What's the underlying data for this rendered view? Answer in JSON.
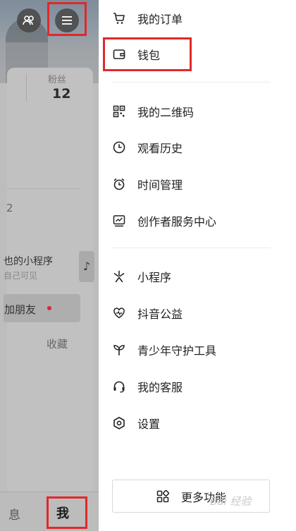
{
  "profile": {
    "fans_label": "粉丝",
    "fans_count": "12",
    "partial_char": "2",
    "mini_program_title": "也的小程序",
    "mini_program_sub": "自己可见",
    "add_friend_label": "加朋友",
    "favorites_tab": "收藏",
    "music_icon_glyph": "♪"
  },
  "bottom_tabs": {
    "messages": "息",
    "me": "我"
  },
  "drawer": {
    "group1": [
      {
        "label": "我的订单",
        "icon": "cart-icon"
      },
      {
        "label": "钱包",
        "icon": "wallet-icon"
      }
    ],
    "group2": [
      {
        "label": "我的二维码",
        "icon": "qr-code-icon"
      },
      {
        "label": "观看历史",
        "icon": "clock-icon"
      },
      {
        "label": "时间管理",
        "icon": "alarm-icon"
      },
      {
        "label": "创作者服务中心",
        "icon": "chart-icon"
      }
    ],
    "group3": [
      {
        "label": "小程序",
        "icon": "mini-program-icon"
      },
      {
        "label": "抖音公益",
        "icon": "heart-icon"
      },
      {
        "label": "青少年守护工具",
        "icon": "sprout-icon"
      },
      {
        "label": "我的客服",
        "icon": "headset-icon"
      },
      {
        "label": "设置",
        "icon": "settings-icon"
      }
    ],
    "more_label": "更多功能"
  },
  "watermark": "Bai 经验",
  "colors": {
    "highlight": "#e0292b",
    "dot": "#d7263d"
  }
}
